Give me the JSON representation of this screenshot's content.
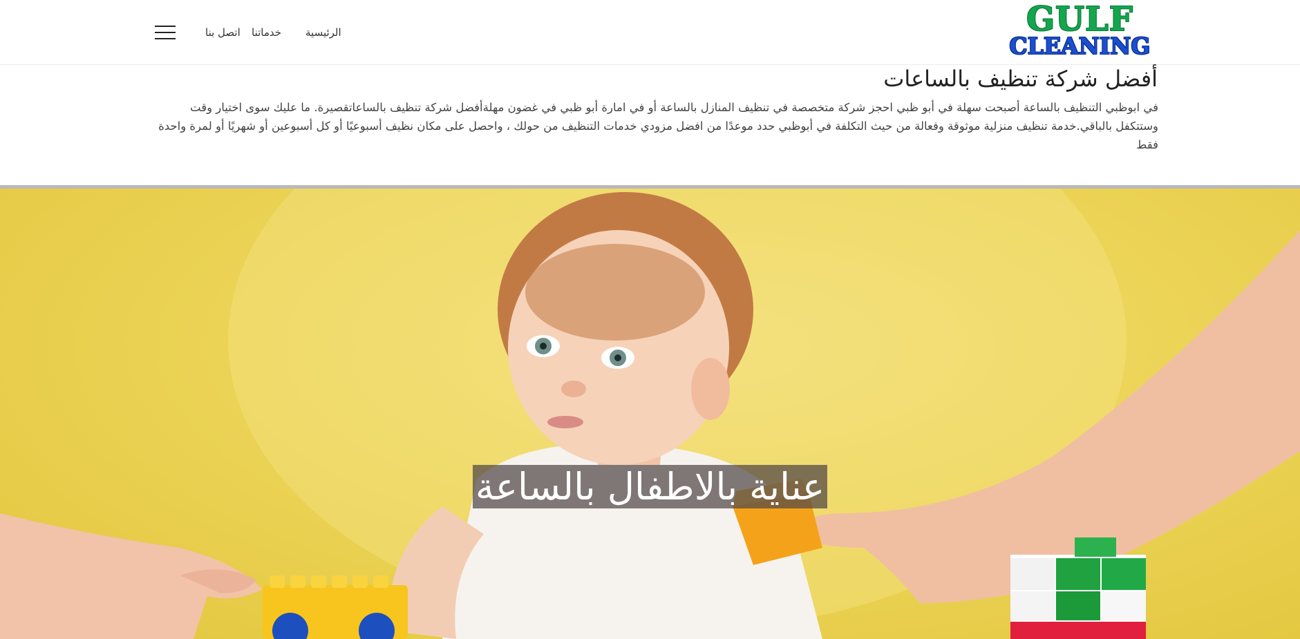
{
  "header": {
    "logo": {
      "line1": "GULF",
      "line2": "CLEANING"
    },
    "nav": {
      "home": "الرئيسية",
      "services": "خدماتنا",
      "contact": "اتصل بنا"
    },
    "menu_icon": "hamburger-menu-icon"
  },
  "intro": {
    "title": "أفضل شركة تنظيف بالساعات",
    "text": "في ابوظبي التنظيف بالساعة أصبحت سهلة في أبو ظبي احجز شركة متخصصة في تنظيف المنازل بالساعة أو في امارة أبو ظبي في غضون مهلةأفضل شركة تنظيف بالساعاتقصيرة. ما عليك سوى اختيار وقت وستتكفل بالباقي.خدمة تنظيف منزلية موثوقة وفعالة من حيث التكلفة في أبوظبي حدد موعدًا من افضل مزودي خدمات التنظيف من حولك ، واحصل على مكان نظيف أسبوعيًا أو كل أسبوعين أو شهريًا أو لمرة واحدة فقط"
  },
  "hero": {
    "caption": "عناية بالاطفال بالساعة",
    "background_color": "#ecd457"
  }
}
